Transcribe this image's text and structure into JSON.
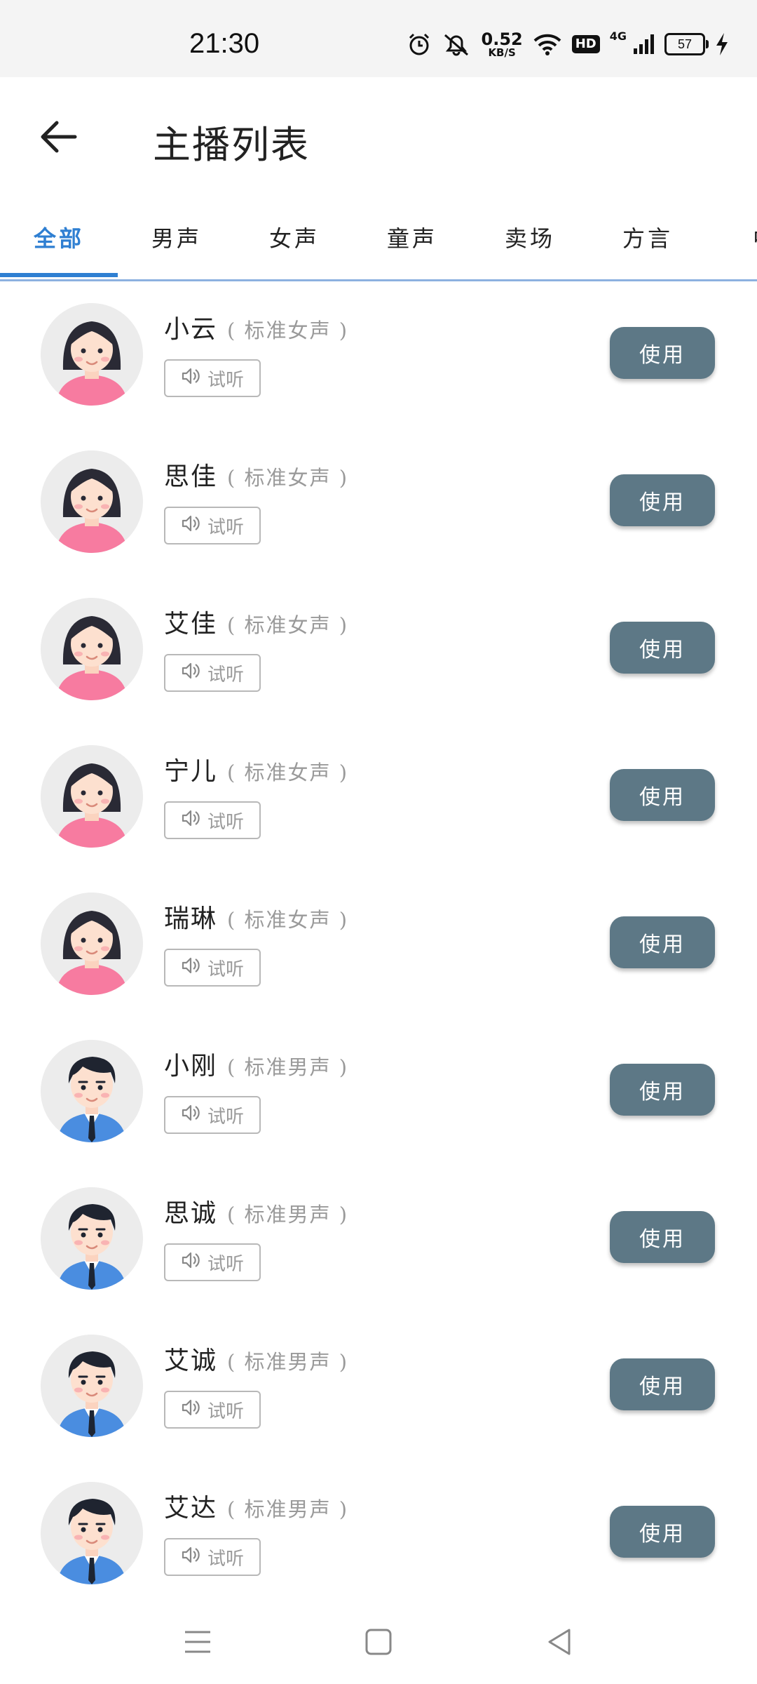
{
  "status_bar": {
    "time": "21:30",
    "net_speed_value": "0.52",
    "net_speed_unit": "KB/S",
    "hd_label": "HD",
    "network_label": "4G",
    "battery_level": "57",
    "icons": [
      "alarm-icon",
      "mute-icon",
      "wifi-icon",
      "signal-icon",
      "battery-icon",
      "charging-icon"
    ]
  },
  "header": {
    "title": "主播列表",
    "back_icon": "arrow-left-icon"
  },
  "tabs": [
    {
      "label": "全部",
      "active": true
    },
    {
      "label": "男声",
      "active": false
    },
    {
      "label": "女声",
      "active": false
    },
    {
      "label": "童声",
      "active": false
    },
    {
      "label": "卖场",
      "active": false
    },
    {
      "label": "方言",
      "active": false
    },
    {
      "label": "中",
      "active": false
    }
  ],
  "list": {
    "listen_label": "试听",
    "use_label": "使用",
    "items": [
      {
        "name": "小云",
        "type": "( 标准女声 )",
        "gender": "female"
      },
      {
        "name": "思佳",
        "type": "( 标准女声 )",
        "gender": "female"
      },
      {
        "name": "艾佳",
        "type": "( 标准女声 )",
        "gender": "female"
      },
      {
        "name": "宁儿",
        "type": "( 标准女声 )",
        "gender": "female"
      },
      {
        "name": "瑞琳",
        "type": "( 标准女声 )",
        "gender": "female"
      },
      {
        "name": "小刚",
        "type": "( 标准男声 )",
        "gender": "male"
      },
      {
        "name": "思诚",
        "type": "( 标准男声 )",
        "gender": "male"
      },
      {
        "name": "艾诚",
        "type": "( 标准男声 )",
        "gender": "male"
      },
      {
        "name": "艾达",
        "type": "( 标准男声 )",
        "gender": "male"
      }
    ]
  },
  "nav_bar": {
    "icons": [
      "menu-icon",
      "home-square-icon",
      "back-triangle-icon"
    ]
  },
  "colors": {
    "accent": "#2f7fd2",
    "use_button": "#5d7886",
    "female_shirt": "#f77ba0",
    "male_suit": "#4a8de0"
  }
}
